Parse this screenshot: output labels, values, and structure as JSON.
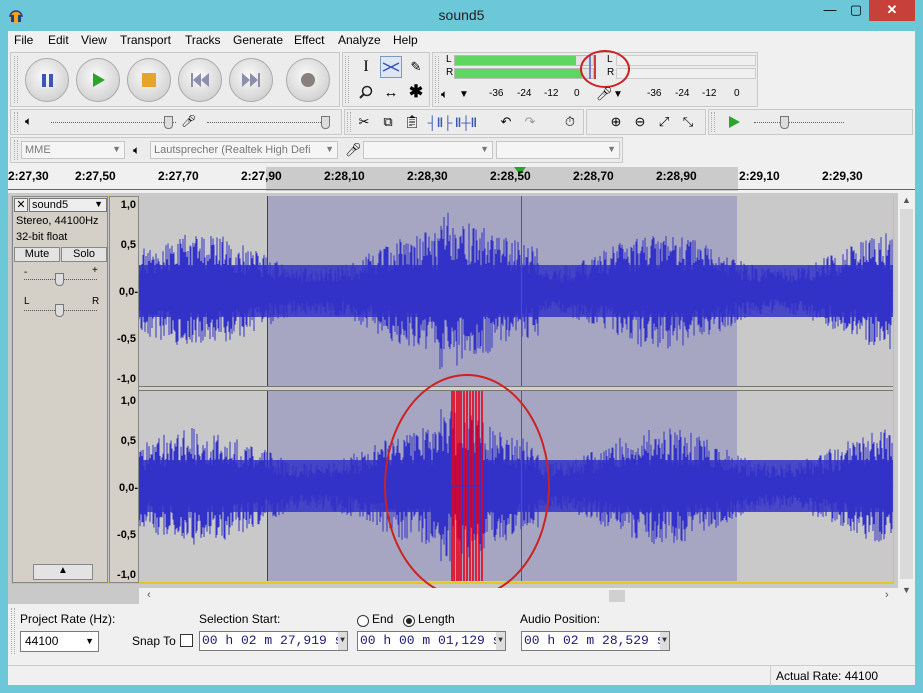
{
  "window": {
    "title": "sound5",
    "min_label": "—",
    "max_label": "▢",
    "close_label": "✕"
  },
  "menu": [
    "File",
    "Edit",
    "View",
    "Transport",
    "Tracks",
    "Generate",
    "Effect",
    "Analyze",
    "Help"
  ],
  "meters": {
    "rec_l": "L",
    "rec_r": "R",
    "play_l": "L",
    "play_r": "R",
    "scale_play": [
      "-36",
      "-24",
      "-12",
      "0"
    ],
    "scale_rec": [
      "-36",
      "-24",
      "-12",
      "0"
    ],
    "play_level_l": 0.88,
    "play_level_r": 0.92
  },
  "device": {
    "host": "MME",
    "output": "Lautsprecher (Realtek High Defi",
    "input": "",
    "channels": ""
  },
  "ruler": {
    "ticks": [
      "2:27,30",
      "2:27,50",
      "2:27,70",
      "2:27,90",
      "2:28,10",
      "2:28,30",
      "2:28,50",
      "2:28,70",
      "2:28,90",
      "2:29,10",
      "2:29,30"
    ]
  },
  "track": {
    "name": "sound5",
    "info1": "Stereo, 44100Hz",
    "info2": "32-bit float",
    "mute": "Mute",
    "solo": "Solo",
    "gain_minus": "-",
    "gain_plus": "+",
    "pan_l": "L",
    "pan_r": "R",
    "scale": [
      "1,0",
      "0,5",
      "0,0-",
      "-0,5",
      "-1,0"
    ]
  },
  "bottom": {
    "project_rate_label": "Project Rate (Hz):",
    "project_rate": "44100",
    "snap_to": "Snap To",
    "selection_start_label": "Selection Start:",
    "end_label": "End",
    "length_label": "Length",
    "audio_position_label": "Audio Position:",
    "selection_start": "00 h 02 m 27,919 s",
    "length": "00 h 00 m 01,129 s",
    "audio_position": "00 h 02 m 28,529 s"
  },
  "status": {
    "actual_rate": "Actual Rate: 44100"
  },
  "colors": {
    "waveform": "#3232c8",
    "clip": "#e8001c",
    "selection": "#a6a6c2",
    "annotation": "#cc2222",
    "meter_green": "#5fd65f"
  }
}
